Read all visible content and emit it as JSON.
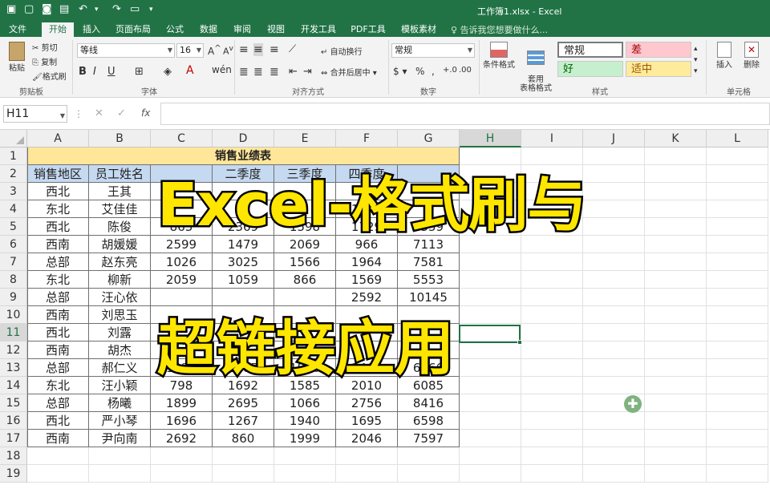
{
  "titlebar": {
    "title": "工作簿1.xlsx - Excel"
  },
  "tabs": [
    "文件",
    "开始",
    "插入",
    "页面布局",
    "公式",
    "数据",
    "审阅",
    "视图",
    "开发工具",
    "PDF工具",
    "模板素材"
  ],
  "tell_me": "告诉我您想要做什么...",
  "ribbon": {
    "clipboard": {
      "paste": "粘贴",
      "cut": "剪切",
      "copy": "复制",
      "format_painter": "格式刷",
      "label": "剪贴板"
    },
    "font": {
      "name": "等线",
      "size": "16",
      "label": "字体"
    },
    "alignment": {
      "wrap": "自动换行",
      "merge": "合并后居中",
      "label": "对齐方式"
    },
    "number": {
      "format": "常规",
      "label": "数字"
    },
    "styles": {
      "conditional": "条件格式",
      "table": "套用\n表格格式",
      "normal": "常规",
      "bad": "差",
      "good": "好",
      "neutral": "适中",
      "label": "样式"
    },
    "cells": {
      "insert": "插入",
      "delete": "删除",
      "label": "单元格"
    }
  },
  "formula_bar": {
    "name_box": "H11",
    "fx": "fx",
    "value": ""
  },
  "columns": [
    "A",
    "B",
    "C",
    "D",
    "E",
    "F",
    "G",
    "H",
    "I",
    "J",
    "K",
    "L"
  ],
  "rows": [
    "1",
    "2",
    "3",
    "4",
    "5",
    "6",
    "7",
    "8",
    "9",
    "10",
    "11",
    "12",
    "13",
    "14",
    "15",
    "16",
    "17",
    "18",
    "19"
  ],
  "selected_cell": "H11",
  "sheet": {
    "title": "销售业绩表",
    "headers": [
      "销售地区",
      "员工姓名",
      "",
      "二季度",
      "三季度",
      "四季度",
      ""
    ],
    "rows": [
      [
        "西北",
        "王其",
        "",
        "",
        "",
        "",
        ""
      ],
      [
        "东北",
        "艾佳佳",
        "",
        "",
        "",
        "1646",
        ""
      ],
      [
        "西北",
        "陈俊",
        "863",
        "2369",
        "1598",
        "1729",
        "6559"
      ],
      [
        "西南",
        "胡媛媛",
        "2599",
        "1479",
        "2069",
        "966",
        "7113"
      ],
      [
        "总部",
        "赵东亮",
        "1026",
        "3025",
        "1566",
        "1964",
        "7581"
      ],
      [
        "东北",
        "柳新",
        "2059",
        "1059",
        "866",
        "1569",
        "5553"
      ],
      [
        "总部",
        "汪心依",
        "",
        "",
        "",
        "2592",
        "10145"
      ],
      [
        "西南",
        "刘思玉",
        "",
        "",
        "",
        "",
        ""
      ],
      [
        "西北",
        "刘露",
        "",
        "",
        "",
        "",
        ""
      ],
      [
        "西南",
        "胡杰",
        "",
        "",
        "",
        "",
        ""
      ],
      [
        "总部",
        "郝仁义",
        "1320",
        "1587",
        "1890",
        "2469",
        "6766"
      ],
      [
        "东北",
        "汪小颖",
        "798",
        "1692",
        "1585",
        "2010",
        "6085"
      ],
      [
        "总部",
        "杨曦",
        "1899",
        "2695",
        "1066",
        "2756",
        "8416"
      ],
      [
        "西北",
        "严小琴",
        "1696",
        "1267",
        "1940",
        "1695",
        "6598"
      ],
      [
        "西南",
        "尹向南",
        "2692",
        "860",
        "1999",
        "2046",
        "7597"
      ]
    ]
  },
  "overlay": {
    "line1": "Excel-格式刷与",
    "line2": "超链接应用"
  },
  "colors": {
    "excel_green": "#217346",
    "title_fill": "#ffe699",
    "header_fill": "#c5d9f1",
    "overlay_text": "#ffe600"
  }
}
